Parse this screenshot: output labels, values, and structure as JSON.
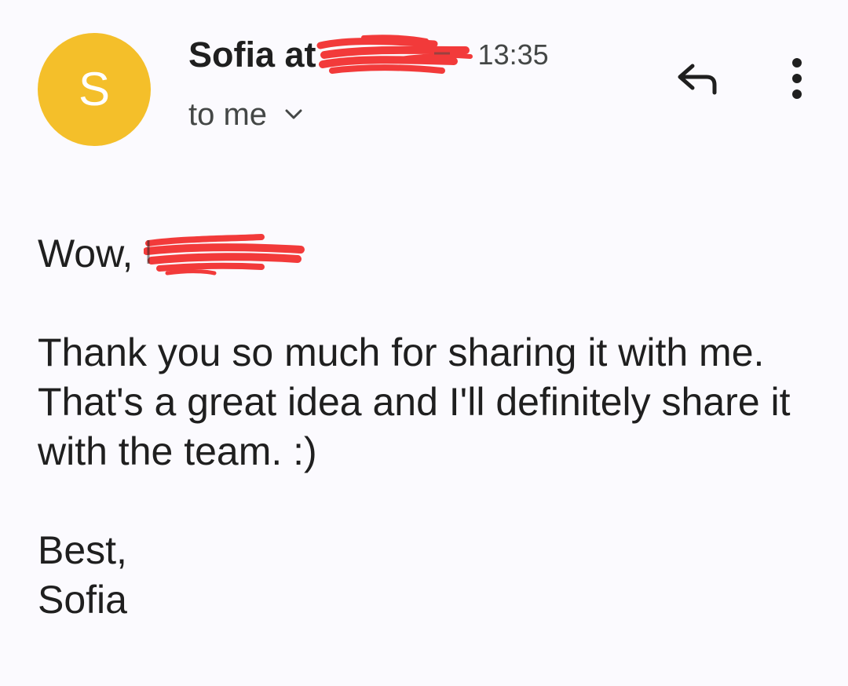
{
  "avatar": {
    "letter": "S",
    "color": "#f4bf2a"
  },
  "header": {
    "sender": "Sofia at",
    "time": "13:35",
    "recipient": "to me",
    "icons": {
      "expand": "chevron-down-icon",
      "reply": "reply-icon",
      "more": "more-vert-icon"
    }
  },
  "message": {
    "greeting": "Wow,",
    "body": "Thank you so much for sharing it with me. That's a great idea and I'll definitely share it with the team. :)",
    "closing": "Best,",
    "signature": "Sofia"
  },
  "colors": {
    "redaction": "#f23a3a",
    "text": "#1f1f1f",
    "secondary": "#444746",
    "background": "#fbfafe"
  }
}
